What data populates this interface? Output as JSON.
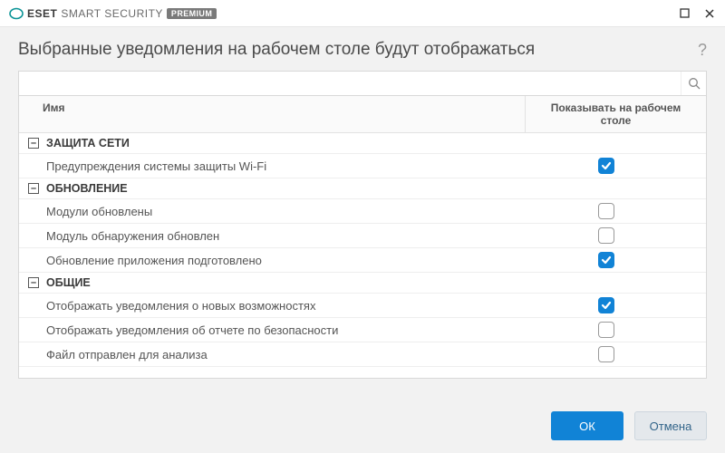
{
  "titlebar": {
    "brand_eset": "ESET",
    "brand_smart": "SMART SECURITY",
    "brand_premium": "PREMIUM"
  },
  "header": {
    "title": "Выбранные уведомления на рабочем столе будут отображаться",
    "help": "?"
  },
  "search": {
    "value": ""
  },
  "columns": {
    "name": "Имя",
    "show": "Показывать на рабочем столе"
  },
  "groups": [
    {
      "label": "ЗАЩИТА СЕТИ",
      "items": [
        {
          "label": "Предупреждения системы защиты Wi-Fi",
          "checked": true
        }
      ]
    },
    {
      "label": "ОБНОВЛЕНИЕ",
      "items": [
        {
          "label": "Модули обновлены",
          "checked": false
        },
        {
          "label": "Модуль обнаружения обновлен",
          "checked": false
        },
        {
          "label": "Обновление приложения подготовлено",
          "checked": true
        }
      ]
    },
    {
      "label": "ОБЩИЕ",
      "items": [
        {
          "label": "Отображать уведомления о новых возможностях",
          "checked": true
        },
        {
          "label": "Отображать уведомления об отчете по безопасности",
          "checked": false
        },
        {
          "label": "Файл отправлен для анализа",
          "checked": false
        }
      ]
    }
  ],
  "buttons": {
    "ok": "ОК",
    "cancel": "Отмена"
  },
  "collapse_glyph": "–"
}
